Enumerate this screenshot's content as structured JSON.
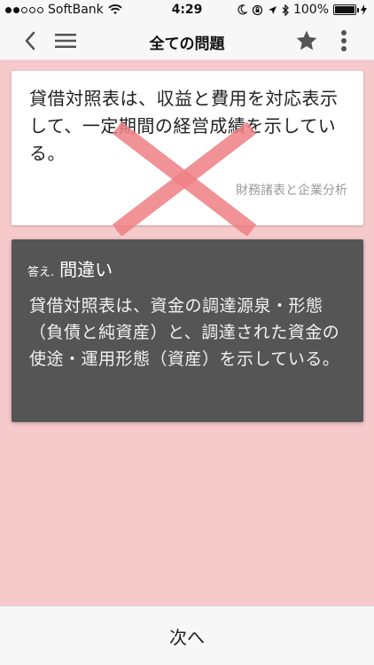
{
  "status_bar": {
    "carrier": "SoftBank",
    "time": "4:29",
    "battery": "100%",
    "battery_level": 1.0,
    "signal_bars_filled": 2,
    "signal_bars_total": 5
  },
  "nav": {
    "title": "全ての問題",
    "icons": [
      "chevron-left-icon",
      "menu-icon",
      "star-icon",
      "more-vertical-icon"
    ]
  },
  "question": {
    "text": "貸借対照表は、収益と費用を対応表示して、一定期間の経営成績を示している。",
    "category": "財務諸表と企業分析"
  },
  "answer": {
    "prefix": "答え.",
    "result": "間違い",
    "explanation": "貸借対照表は、資金の調達源泉・形態（負債と純資産）と、調達された資金の使途・運用形態（資産）を示している。"
  },
  "next_button": {
    "label": "次へ"
  },
  "colors": {
    "background": "#f6c9cb",
    "answer_card": "#555555",
    "x_mark": "#ee7f84",
    "bar": "#f7f7f7"
  }
}
